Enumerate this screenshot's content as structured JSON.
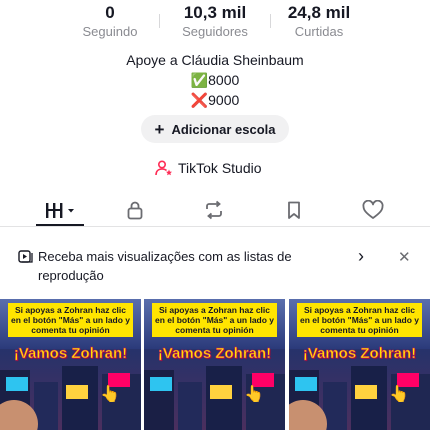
{
  "stats": [
    {
      "value": "0",
      "label": "Seguindo"
    },
    {
      "value": "10,3 mil",
      "label": "Seguidores"
    },
    {
      "value": "24,8 mil",
      "label": "Curtidas"
    }
  ],
  "bio": {
    "line1": "Apoye a Cláudia Sheinbaum",
    "line2": "✅8000",
    "line3": "❌9000"
  },
  "add_school": {
    "label": "Adicionar escola"
  },
  "studio": {
    "label": "TikTok Studio"
  },
  "tabs": [
    {
      "icon": "videos-grid-icon",
      "active": true
    },
    {
      "icon": "lock-icon",
      "active": false
    },
    {
      "icon": "repost-icon",
      "active": false
    },
    {
      "icon": "bookmark-icon",
      "active": false
    },
    {
      "icon": "heart-icon",
      "active": false
    }
  ],
  "banner": {
    "text": "Receba mais visualizações com as listas de reprodução",
    "icon": "playlist-icon"
  },
  "videos": [
    {
      "caption": "Si apoyas a Zohran haz clic en el botón \"Más\" a un lado y comenta tu opinión",
      "headline": "¡Vamos Zohran!"
    },
    {
      "caption": "Si apoyas a Zohran haz clic en el botón \"Más\" a un lado y comenta tu opinión",
      "headline": "¡Vamos Zohran!"
    },
    {
      "caption": "Si apoyas a Zohran haz clic en el botón \"Más\" a un lado y comenta tu opinión",
      "headline": "¡Vamos Zohran!"
    }
  ],
  "colors": {
    "text": "#161823",
    "secondary": "#8a8b91",
    "pill_bg": "#f1f1f2",
    "caption_bg": "#ffe500",
    "studio_accent": "#fe2c55"
  }
}
